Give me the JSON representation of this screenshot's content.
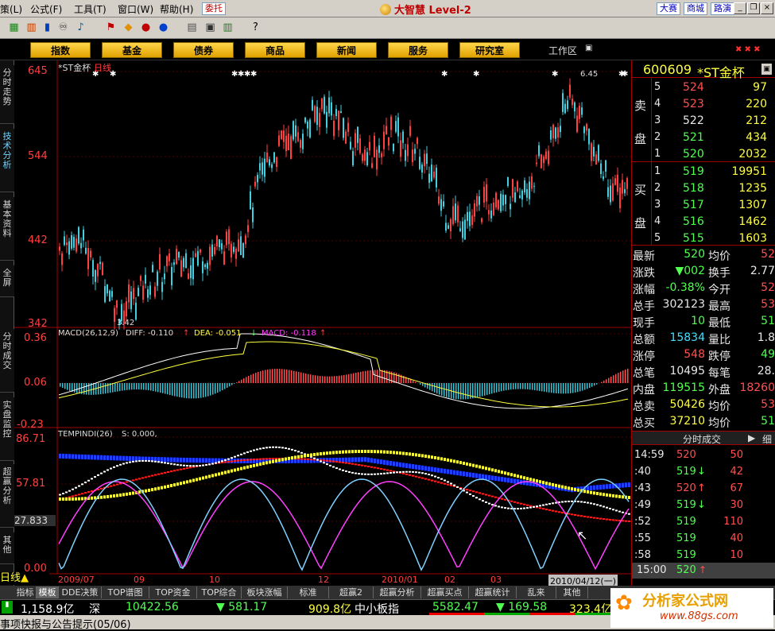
{
  "menu": {
    "items": [
      "策(L)",
      "公式(F)",
      "工具(T)",
      "窗口(W)",
      "帮助(H)"
    ],
    "entrust": "委托",
    "brand": "大智慧 Level-2",
    "links": [
      "大赛",
      "商城",
      "路演"
    ]
  },
  "tabs": [
    "指数",
    "基金",
    "债券",
    "商品",
    "新闻",
    "服务",
    "研究室"
  ],
  "workspace_label": "工作区",
  "left_tabs": [
    "分时走势",
    "技术分析",
    "基本资料",
    "全屏",
    "分时成交",
    "实盘监控",
    "超赢分析",
    "其他"
  ],
  "chart": {
    "stock_name": "*ST金杯",
    "period": "日线",
    "price_axis": [
      "645",
      "544",
      "442",
      "342"
    ],
    "high_marker": "6.45",
    "low_marker": "3.42",
    "macd_label": "MACD(26,12,9)",
    "diff": "DIFF: -0.110",
    "dea": "DEA: -0.051",
    "macd": "MACD: -0.118",
    "macd_axis": [
      "0.36",
      "0.06",
      "-0.23"
    ],
    "temp_label": "TEMPINDI(26)",
    "temp_s": "S: 0.000,",
    "temp_axis": [
      "86.71",
      "57.81",
      "27.833",
      "0.00"
    ],
    "dates": [
      "2009/07",
      "09",
      "10",
      "12",
      "2010/01",
      "02",
      "03",
      "2010/04/12(一)"
    ],
    "period_btn": "日线"
  },
  "quote": {
    "code": "600609",
    "name": "*ST金杯",
    "sell_label": [
      "卖",
      "盘"
    ],
    "buy_label": [
      "买",
      "盘"
    ],
    "sells": [
      {
        "lvl": "5",
        "price": "524",
        "vol": "97"
      },
      {
        "lvl": "4",
        "price": "523",
        "vol": "220"
      },
      {
        "lvl": "3",
        "price": "522",
        "vol": "212"
      },
      {
        "lvl": "2",
        "price": "521",
        "vol": "434"
      },
      {
        "lvl": "1",
        "price": "520",
        "vol": "2032"
      }
    ],
    "buys": [
      {
        "lvl": "1",
        "price": "519",
        "vol": "19951"
      },
      {
        "lvl": "2",
        "price": "518",
        "vol": "1235"
      },
      {
        "lvl": "3",
        "price": "517",
        "vol": "1307"
      },
      {
        "lvl": "4",
        "price": "516",
        "vol": "1462"
      },
      {
        "lvl": "5",
        "price": "515",
        "vol": "1603"
      }
    ],
    "stats": [
      {
        "l": "最新",
        "v": "520",
        "l2": "均价",
        "v2": "52"
      },
      {
        "l": "涨跌",
        "v": "▼002",
        "l2": "换手",
        "v2": "2.77"
      },
      {
        "l": "涨幅",
        "v": "-0.38%",
        "l2": "今开",
        "v2": "52"
      },
      {
        "l": "总手",
        "v": "302123",
        "l2": "最高",
        "v2": "53"
      },
      {
        "l": "现手",
        "v": "10",
        "l2": "最低",
        "v2": "51"
      },
      {
        "l": "总额",
        "v": "15834",
        "l2": "量比",
        "v2": "1.8"
      },
      {
        "l": "涨停",
        "v": "548",
        "l2": "跌停",
        "v2": "49"
      },
      {
        "l": "总笔",
        "v": "10495",
        "l2": "每笔",
        "v2": "28."
      },
      {
        "l": "内盘",
        "v": "119515",
        "l2": "外盘",
        "v2": "18260"
      },
      {
        "l": "总卖",
        "v": "50426",
        "l2": "均价",
        "v2": "53"
      },
      {
        "l": "总买",
        "v": "37210",
        "l2": "均价",
        "v2": "51"
      }
    ],
    "ticks_title": "分时成交",
    "ticks_tab2": "细",
    "ticks": [
      {
        "t": "14:59",
        "p": "520",
        "v": "50",
        "arrow": ""
      },
      {
        "t": ":40",
        "p": "519",
        "v": "42",
        "arrow": "↓"
      },
      {
        "t": ":43",
        "p": "520",
        "v": "67",
        "arrow": "↑"
      },
      {
        "t": ":49",
        "p": "519",
        "v": "30",
        "arrow": "↓"
      },
      {
        "t": ":52",
        "p": "519",
        "v": "110",
        "arrow": ""
      },
      {
        "t": ":55",
        "p": "519",
        "v": "40",
        "arrow": ""
      },
      {
        "t": ":58",
        "p": "519",
        "v": "10",
        "arrow": ""
      }
    ],
    "last_time": "15:00",
    "last_price": "520"
  },
  "bottom_tabs": [
    "指标",
    "模板",
    "DDE决策",
    "TOP谱图",
    "TOP资金",
    "TOP综合",
    "板块涨幅",
    "标准",
    "超赢2",
    "超赢分析",
    "超赢买点",
    "超赢统计",
    "乱来",
    "其他"
  ],
  "status": {
    "sh_val": "1,158.9亿",
    "sz_label": "深",
    "sz_index": "10422.56",
    "sz_change": "▼ 581.17",
    "sz_amount": "909.8亿",
    "sme_label": "中小板指",
    "sme_index": "5582.47",
    "sme_change": "▼ 169.58",
    "sme_amount": "323.4亿"
  },
  "news": "事项快报与公告提示(05/06)",
  "watermark": {
    "name": "分析家公式网",
    "url": "www.88gs.com"
  }
}
